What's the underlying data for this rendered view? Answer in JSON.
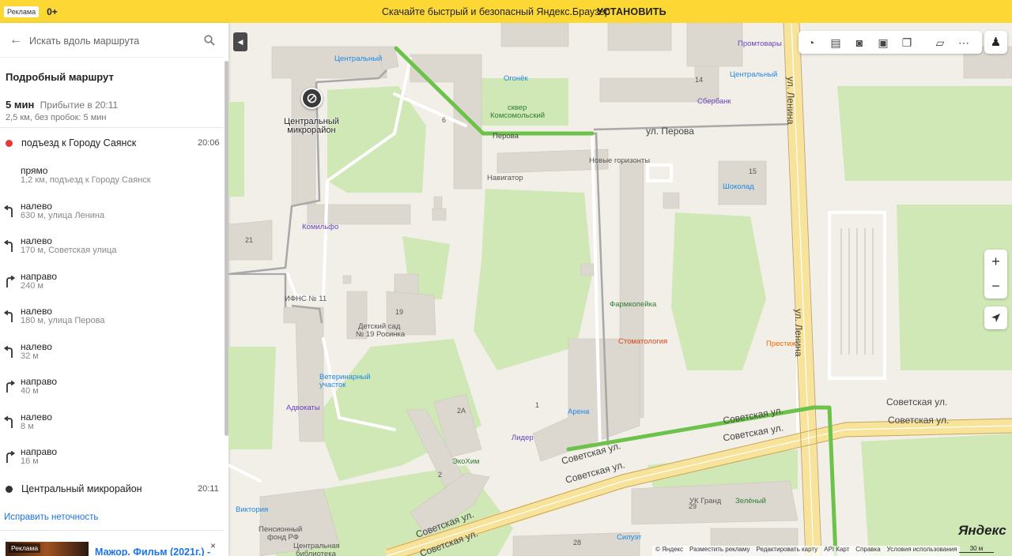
{
  "banner": {
    "ad_label": "Реклама",
    "age_label": "0+",
    "promo_text": "Скачайте быстрый и безопасный Яндекс.Браузер",
    "install_label": "УСТАНОВИТЬ",
    "color": "#fdd835"
  },
  "search": {
    "placeholder": "Искать вдоль маршрута"
  },
  "route": {
    "title": "Подробный маршрут",
    "duration": "5 мин",
    "arrival": "Прибытие в 20:11",
    "distance_note": "2,5 км, без пробок: 5 мин",
    "start": {
      "name": "подъезд к Городу Саянск",
      "time": "20:06",
      "color": "#e53935"
    },
    "steps": [
      {
        "name": "прямо",
        "detail": "1,2 км, подъезд к Городу Саянск",
        "icon": "straight"
      },
      {
        "name": "налево",
        "detail": "630 м, улица Ленина",
        "icon": "turn-left-icon"
      },
      {
        "name": "налево",
        "detail": "170 м, Советская улица",
        "icon": "turn-left-icon"
      },
      {
        "name": "направо",
        "detail": "240 м",
        "icon": "turn-right-icon"
      },
      {
        "name": "налево",
        "detail": "180 м, улица Перова",
        "icon": "turn-left-icon"
      },
      {
        "name": "налево",
        "detail": "32 м",
        "icon": "turn-left-icon"
      },
      {
        "name": "направо",
        "detail": "40 м",
        "icon": "turn-right-icon"
      },
      {
        "name": "налево",
        "detail": "8 м",
        "icon": "turn-left-icon"
      },
      {
        "name": "направо",
        "detail": "16 м",
        "icon": "turn-right-icon"
      }
    ],
    "end": {
      "name": "Центральный микрорайон",
      "time": "20:11",
      "color": "#333333"
    },
    "fix_link": "Исправить неточность"
  },
  "ad": {
    "badge": "Реклама",
    "title": "Мажор. Фильм (2021г.) -",
    "close": "×"
  },
  "map": {
    "route_color": "#6cc24a",
    "pin_label_line1": "Центральный",
    "pin_label_line2": "микрорайон",
    "streets": {
      "perova_1": "ул. Перова",
      "perova_2": "Перова",
      "lenina_1": "ул. Ленина",
      "lenina_2": "ул. Ленина",
      "sovet_1": "Советская ул.",
      "sovet_2": "Советская ул.",
      "sovet_3": "Советская ул.",
      "sovet_4": "Советская ул.",
      "sovet_5": "Советская ул.",
      "sovet_6": "Советская ул.",
      "sovet_7": "Советская ул.",
      "sovet_8": "Советская ул."
    },
    "pois": {
      "tsentralny_1": "Центральный",
      "tsentralny_2": "Центральный",
      "ogonek": "Огонёк",
      "promtovary": "Промтовары",
      "skver_1": "сквер",
      "skver_2": "Комсомольский",
      "sberbank": "Сбербанк",
      "novye_gorizonty": "Новые горизонты",
      "navigator": "Навигатор",
      "shokolad": "Шоколад",
      "komilfo": "Комильфо",
      "ifns": "ИФНС № 11",
      "detsad_1": "Детский сад",
      "detsad_2": "№ 19 Росинка",
      "farmkopeyka": "Фармкопейка",
      "stomatologiya": "Стоматология",
      "prestizh": "Престиж",
      "vet_1": "Ветеринарный",
      "vet_2": "участок",
      "advokaty": "Адвокаты",
      "arena": "Арена",
      "lider": "Лидер",
      "ekohim": "ЭкоХим",
      "viktoriya": "Виктория",
      "pensfond_1": "Пенсионный",
      "pensfond_2": "фонд РФ",
      "biblioteka_1": "Центральная",
      "biblioteka_2": "библиотека",
      "uk_grand": "УК Гранд",
      "zeleny": "Зелёный",
      "siluet": "Силуэт"
    },
    "house_numbers": {
      "h14": "14",
      "h6": "6",
      "h15": "15",
      "h21": "21",
      "h19": "19",
      "h1": "1",
      "h2a": "2А",
      "h2": "2",
      "h29": "29",
      "h28": "28"
    },
    "zoom_in": "+",
    "zoom_out": "−",
    "logo": "Яндекс",
    "scale": "30 м",
    "footer": [
      "© Яндекс",
      "Разместить рекламу",
      "Редактировать карту",
      "API Карт",
      "Справка",
      "Условия использования"
    ]
  }
}
